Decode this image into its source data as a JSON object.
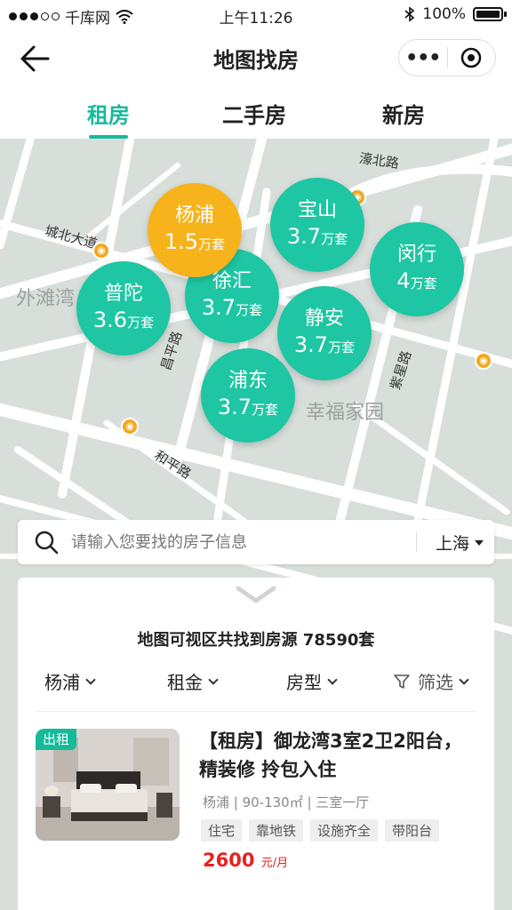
{
  "status_bar": {
    "carrier": "千库网",
    "time": "上午11:26",
    "battery": "100%"
  },
  "nav": {
    "title": "地图找房",
    "more_glyph": "•••"
  },
  "tabs": [
    {
      "label": "租房",
      "active": true
    },
    {
      "label": "二手房",
      "active": false
    },
    {
      "label": "新房",
      "active": false
    }
  ],
  "map": {
    "area_labels": [
      "外滩湾",
      "幸福家园"
    ],
    "roads": [
      "濠北路",
      "城北大道",
      "昌平路",
      "紫星路",
      "和平路"
    ],
    "bubbles": [
      {
        "name": "杨浦",
        "count": "1.5",
        "unit": "万套",
        "highlight": true
      },
      {
        "name": "宝山",
        "count": "3.7",
        "unit": "万套",
        "highlight": false
      },
      {
        "name": "闵行",
        "count": "4",
        "unit": "万套",
        "highlight": false
      },
      {
        "name": "普陀",
        "count": "3.6",
        "unit": "万套",
        "highlight": false
      },
      {
        "name": "徐汇",
        "count": "3.7",
        "unit": "万套",
        "highlight": false
      },
      {
        "name": "静安",
        "count": "3.7",
        "unit": "万套",
        "highlight": false
      },
      {
        "name": "浦东",
        "count": "3.7",
        "unit": "万套",
        "highlight": false
      }
    ]
  },
  "search": {
    "placeholder": "请输入您要找的房子信息",
    "city": "上海"
  },
  "results": {
    "summary": "地图可视区共找到房源 78590套",
    "filters": [
      "杨浦",
      "租金",
      "房型",
      "筛选"
    ]
  },
  "listing": {
    "badge": "出租",
    "title": "【租房】御龙湾3室2卫2阳台，精装修 拎包入住",
    "meta": "杨浦 | 90-130㎡ | 三室一厅",
    "tags": [
      "住宅",
      "靠地铁",
      "设施齐全",
      "带阳台"
    ],
    "price": "2600",
    "price_unit": "元/月"
  },
  "colors": {
    "accent": "#16b99a",
    "bubble": "#1ec6a3",
    "highlight": "#f7b31c",
    "price": "#e8211f"
  }
}
